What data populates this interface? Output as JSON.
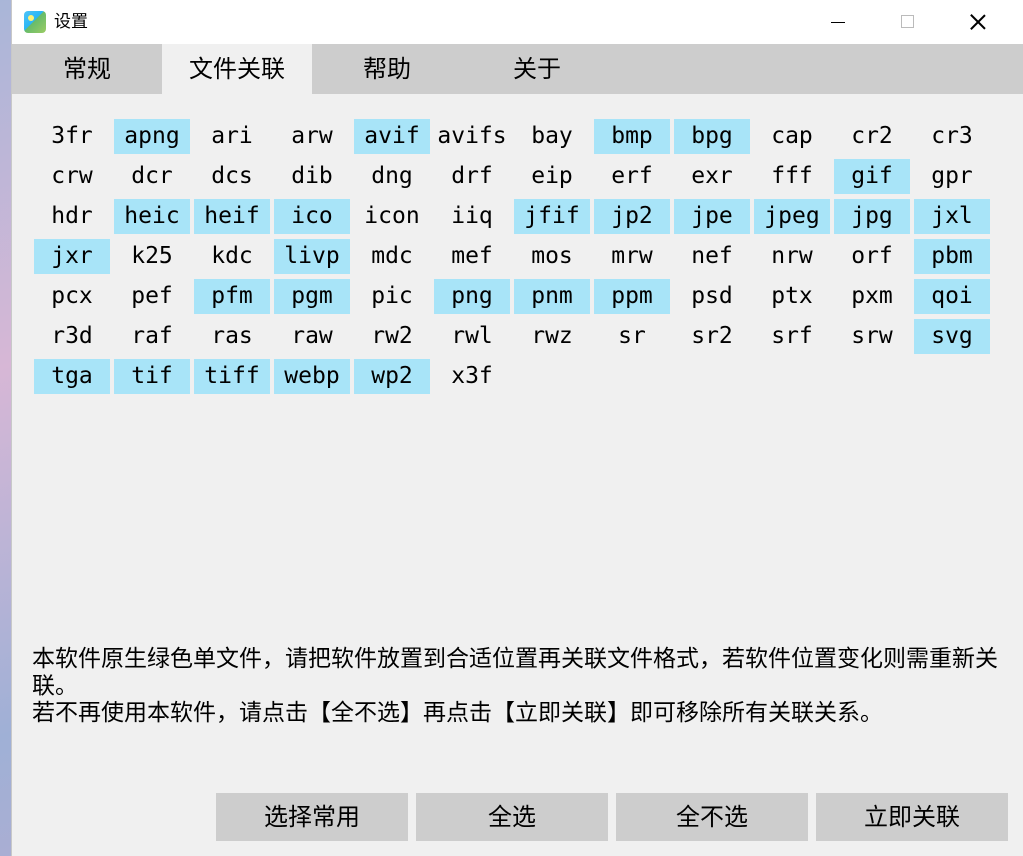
{
  "window": {
    "title": "设置"
  },
  "tabs": [
    {
      "label": "常规",
      "active": false
    },
    {
      "label": "文件关联",
      "active": true
    },
    {
      "label": "帮助",
      "active": false
    },
    {
      "label": "关于",
      "active": false
    }
  ],
  "extensions": [
    {
      "name": "3fr",
      "selected": false
    },
    {
      "name": "apng",
      "selected": true
    },
    {
      "name": "ari",
      "selected": false
    },
    {
      "name": "arw",
      "selected": false
    },
    {
      "name": "avif",
      "selected": true
    },
    {
      "name": "avifs",
      "selected": false
    },
    {
      "name": "bay",
      "selected": false
    },
    {
      "name": "bmp",
      "selected": true
    },
    {
      "name": "bpg",
      "selected": true
    },
    {
      "name": "cap",
      "selected": false
    },
    {
      "name": "cr2",
      "selected": false
    },
    {
      "name": "cr3",
      "selected": false
    },
    {
      "name": "crw",
      "selected": false
    },
    {
      "name": "dcr",
      "selected": false
    },
    {
      "name": "dcs",
      "selected": false
    },
    {
      "name": "dib",
      "selected": false
    },
    {
      "name": "dng",
      "selected": false
    },
    {
      "name": "drf",
      "selected": false
    },
    {
      "name": "eip",
      "selected": false
    },
    {
      "name": "erf",
      "selected": false
    },
    {
      "name": "exr",
      "selected": false
    },
    {
      "name": "fff",
      "selected": false
    },
    {
      "name": "gif",
      "selected": true
    },
    {
      "name": "gpr",
      "selected": false
    },
    {
      "name": "hdr",
      "selected": false
    },
    {
      "name": "heic",
      "selected": true
    },
    {
      "name": "heif",
      "selected": true
    },
    {
      "name": "ico",
      "selected": true
    },
    {
      "name": "icon",
      "selected": false
    },
    {
      "name": "iiq",
      "selected": false
    },
    {
      "name": "jfif",
      "selected": true
    },
    {
      "name": "jp2",
      "selected": true
    },
    {
      "name": "jpe",
      "selected": true
    },
    {
      "name": "jpeg",
      "selected": true
    },
    {
      "name": "jpg",
      "selected": true
    },
    {
      "name": "jxl",
      "selected": true
    },
    {
      "name": "jxr",
      "selected": true
    },
    {
      "name": "k25",
      "selected": false
    },
    {
      "name": "kdc",
      "selected": false
    },
    {
      "name": "livp",
      "selected": true
    },
    {
      "name": "mdc",
      "selected": false
    },
    {
      "name": "mef",
      "selected": false
    },
    {
      "name": "mos",
      "selected": false
    },
    {
      "name": "mrw",
      "selected": false
    },
    {
      "name": "nef",
      "selected": false
    },
    {
      "name": "nrw",
      "selected": false
    },
    {
      "name": "orf",
      "selected": false
    },
    {
      "name": "pbm",
      "selected": true
    },
    {
      "name": "pcx",
      "selected": false
    },
    {
      "name": "pef",
      "selected": false
    },
    {
      "name": "pfm",
      "selected": true
    },
    {
      "name": "pgm",
      "selected": true
    },
    {
      "name": "pic",
      "selected": false
    },
    {
      "name": "png",
      "selected": true
    },
    {
      "name": "pnm",
      "selected": true
    },
    {
      "name": "ppm",
      "selected": true
    },
    {
      "name": "psd",
      "selected": false
    },
    {
      "name": "ptx",
      "selected": false
    },
    {
      "name": "pxm",
      "selected": false
    },
    {
      "name": "qoi",
      "selected": true
    },
    {
      "name": "r3d",
      "selected": false
    },
    {
      "name": "raf",
      "selected": false
    },
    {
      "name": "ras",
      "selected": false
    },
    {
      "name": "raw",
      "selected": false
    },
    {
      "name": "rw2",
      "selected": false
    },
    {
      "name": "rwl",
      "selected": false
    },
    {
      "name": "rwz",
      "selected": false
    },
    {
      "name": "sr",
      "selected": false
    },
    {
      "name": "sr2",
      "selected": false
    },
    {
      "name": "srf",
      "selected": false
    },
    {
      "name": "srw",
      "selected": false
    },
    {
      "name": "svg",
      "selected": true
    },
    {
      "name": "tga",
      "selected": true
    },
    {
      "name": "tif",
      "selected": true
    },
    {
      "name": "tiff",
      "selected": true
    },
    {
      "name": "webp",
      "selected": true
    },
    {
      "name": "wp2",
      "selected": true
    },
    {
      "name": "x3f",
      "selected": false
    }
  ],
  "info": {
    "line1": "本软件原生绿色单文件，请把软件放置到合适位置再关联文件格式，若软件位置变化则需重新关联。",
    "line2": "若不再使用本软件，请点击【全不选】再点击【立即关联】即可移除所有关联关系。"
  },
  "buttons": {
    "select_common": "选择常用",
    "select_all": "全选",
    "select_none": "全不选",
    "associate_now": "立即关联"
  },
  "colors": {
    "selected_bg": "#a8e4f8",
    "tabbar_bg": "#cdcdcd",
    "window_bg": "#f0f0f0"
  }
}
